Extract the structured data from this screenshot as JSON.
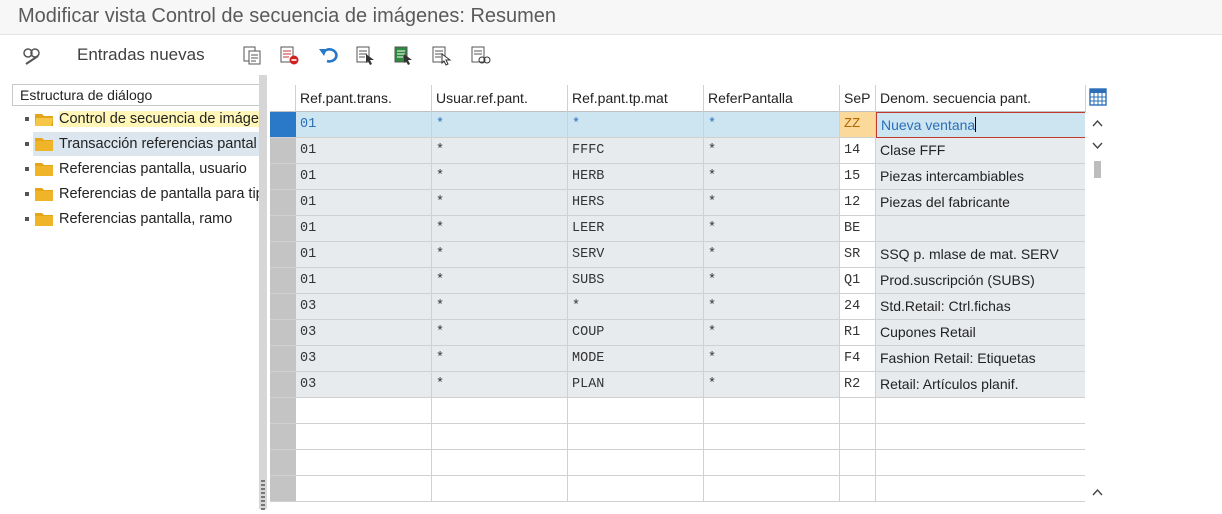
{
  "window": {
    "title": "Modificar vista Control de secuencia de imágenes: Resumen"
  },
  "toolbar": {
    "new_entries_label": "Entradas nuevas"
  },
  "tree": {
    "header": "Estructura de diálogo",
    "items": [
      {
        "label": "Control de secuencia de imáge"
      },
      {
        "label": "Transacción referencias pantal"
      },
      {
        "label": "Referencias pantalla, usuario"
      },
      {
        "label": "Referencias de pantalla para tip"
      },
      {
        "label": "Referencias pantalla, ramo"
      }
    ]
  },
  "table": {
    "columns": [
      "Ref.pant.trans.",
      "Usuar.ref.pant.",
      "Ref.pant.tp.mat",
      "ReferPantalla",
      "SeP",
      "Denom. secuencia pant."
    ],
    "rows": [
      [
        "01",
        "*",
        "*",
        "*",
        "ZZ",
        "Nueva ventana"
      ],
      [
        "01",
        "*",
        "FFFC",
        "*",
        "14",
        "Clase FFF"
      ],
      [
        "01",
        "*",
        "HERB",
        "*",
        "15",
        "Piezas intercambiables"
      ],
      [
        "01",
        "*",
        "HERS",
        "*",
        "12",
        "Piezas del fabricante"
      ],
      [
        "01",
        "*",
        "LEER",
        "*",
        "BE",
        ""
      ],
      [
        "01",
        "*",
        "SERV",
        "*",
        "SR",
        "SSQ p. mlase de mat. SERV"
      ],
      [
        "01",
        "*",
        "SUBS",
        "*",
        "Q1",
        "Prod.suscripción (SUBS)"
      ],
      [
        "03",
        "*",
        "*",
        "*",
        "24",
        "Std.Retail: Ctrl.fichas"
      ],
      [
        "03",
        "*",
        "COUP",
        "*",
        "R1",
        "Cupones Retail"
      ],
      [
        "03",
        "*",
        "MODE",
        "*",
        "F4",
        "Fashion Retail: Etiquetas"
      ],
      [
        "03",
        "*",
        "PLAN",
        "*",
        "R2",
        "Retail: Artículos planif."
      ]
    ],
    "empty_rows": 4
  },
  "colors": {
    "selected_row": "#cde4f1",
    "row_gray": "#e8ebee",
    "zz_cell": "#fbd99a",
    "input_text": "#2a6fb8"
  }
}
